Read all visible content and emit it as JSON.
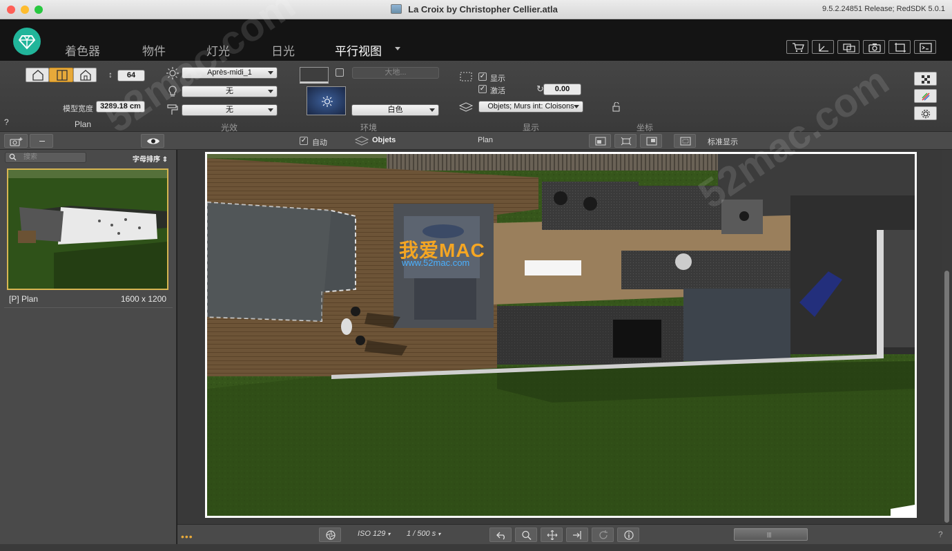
{
  "window": {
    "title": "La Croix by Christopher Cellier.atla",
    "version": "9.5.2.24851 Release; RedSDK 5.0.1"
  },
  "tabs": [
    {
      "label": "着色器",
      "active": false
    },
    {
      "label": "物件",
      "active": false
    },
    {
      "label": "灯光",
      "active": false
    },
    {
      "label": "日光",
      "active": false
    },
    {
      "label": "平行视图",
      "active": true
    }
  ],
  "toolbar": {
    "camera": {
      "height_value": "64",
      "model_width_label": "模型宽度",
      "model_width_value": "3289.18 cm",
      "section_label": "Plan"
    },
    "lighting": {
      "preset": "Après-midi_1",
      "light_value": "无",
      "paint_value": "无",
      "section_label": "光效"
    },
    "environment": {
      "ground_placeholder": "大地...",
      "color": "白色",
      "section_label": "环境"
    },
    "display": {
      "show_label": "显示",
      "show_checked": true,
      "activate_label": "激活",
      "activate_checked": true,
      "angle_value": "0.00",
      "layers": "Objets; Murs int: Cloisons",
      "section_label": "显示"
    },
    "coords_label": "坐标",
    "help": "?"
  },
  "subbar": {
    "auto_label": "自动",
    "auto_checked": true,
    "objects_label": "Objets",
    "view_label": "Plan",
    "standard_label": "标准显示"
  },
  "sidebar": {
    "search_placeholder": "搜索",
    "sort_label": "字母排序",
    "items": [
      {
        "name": "[P] Plan",
        "size": "1600 x 1200"
      }
    ]
  },
  "watermark": {
    "brand": "我爱MAC",
    "url": "www.52mac.com",
    "diagonal": "52mac.com"
  },
  "bottombar": {
    "iso": "ISO 129",
    "shutter": "1 / 500 s",
    "help": "?"
  },
  "colors": {
    "accent": "#21b59a",
    "selection": "#d8b652"
  }
}
